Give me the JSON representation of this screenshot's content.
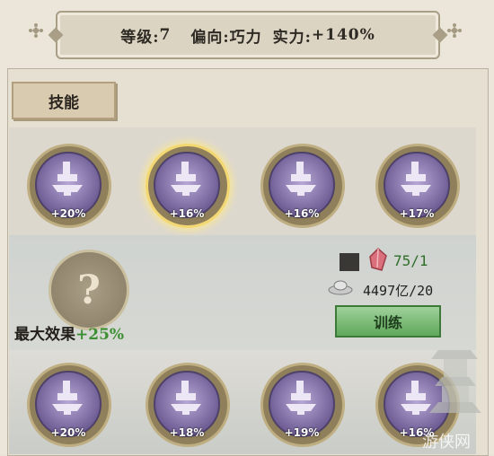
{
  "header": {
    "level_label": "等级:",
    "level_value": "7",
    "tendency_label": "偏向:",
    "tendency_value": "巧力",
    "strength_label": "实力:",
    "strength_value": "+140%"
  },
  "tab": {
    "label": "技能"
  },
  "skills_top": [
    {
      "bonus": "+20%"
    },
    {
      "bonus": "+16%",
      "selected": true
    },
    {
      "bonus": "+16%"
    },
    {
      "bonus": "+17%"
    }
  ],
  "skills_bottom": [
    {
      "bonus": "+20%"
    },
    {
      "bonus": "+18%"
    },
    {
      "bonus": "+19%"
    },
    {
      "bonus": "+16%"
    }
  ],
  "detail": {
    "question_mark": "?",
    "max_effect_label": "最大效果",
    "max_effect_value": "+25%",
    "gem_cost": "75/1",
    "silver_cost": "4497亿/20",
    "train_label": "训练"
  },
  "watermark": "游侠网",
  "colors": {
    "accent_green": "#3c8e33",
    "button_green": "#5fa85a",
    "skill_purple": "#6f5e95",
    "selected_gold": "#f2d773"
  },
  "icons": {
    "skill": "anvil-hammer-icon",
    "cost_item": "dark-square-icon",
    "gem": "red-crystal-icon",
    "currency": "silver-ingot-icon"
  }
}
